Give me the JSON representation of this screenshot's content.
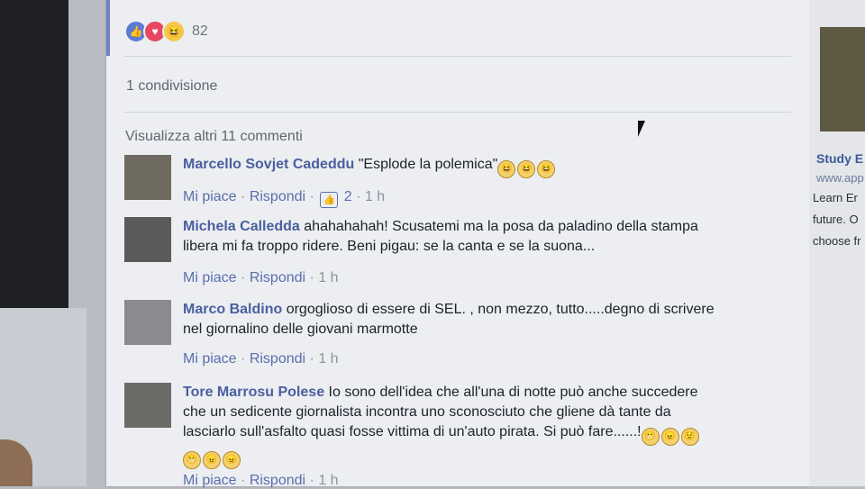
{
  "post": {
    "reactions": {
      "icons": [
        "like-icon",
        "love-icon",
        "haha-icon"
      ],
      "count": "82"
    },
    "shares": "1 condivisione",
    "view_more": "Visualizza altri 11 commenti",
    "comments": [
      {
        "author": "Marcello Sovjet Cadeddu",
        "text": "\"Esplode la polemica\"",
        "emoji_count": 3,
        "like": "Mi piace",
        "reply": "Rispondi",
        "likes": "2",
        "time": "1 h"
      },
      {
        "author": "Michela Calledda",
        "text": "ahahahahah! Scusatemi ma la posa da paladino della stampa libera mi fa troppo ridere. Beni pigau: se la canta e se la suona...",
        "like": "Mi piace",
        "reply": "Rispondi",
        "time": "1 h"
      },
      {
        "author": "Marco Baldino",
        "text": "orgoglioso di essere di SEL. , non mezzo, tutto.....degno di scrivere nel giornalino delle giovani marmotte",
        "like": "Mi piace",
        "reply": "Rispondi",
        "time": "1 h"
      },
      {
        "author": "Tore Marrosu Polese",
        "text": "Io sono dell'idea che all'una di notte può anche succedere che un sedicente giornalista incontra uno sconosciuto che gliene dà tante da lasciarlo sull'asfalto quasi fosse vittima di un'auto pirata. Si può fare......!",
        "like": "Mi piace",
        "reply": "Rispondi",
        "time": "1 h"
      }
    ]
  },
  "sidebar": {
    "ad_title": "Study E",
    "ad_url": "www.app",
    "ad_lines": [
      "Learn Er",
      "future. O",
      "choose fr"
    ]
  },
  "colors": {
    "accent": "#6b83c0",
    "link": "#4a5f9e",
    "like_blue": "#5b7bd5",
    "love_red": "#e8475f"
  }
}
